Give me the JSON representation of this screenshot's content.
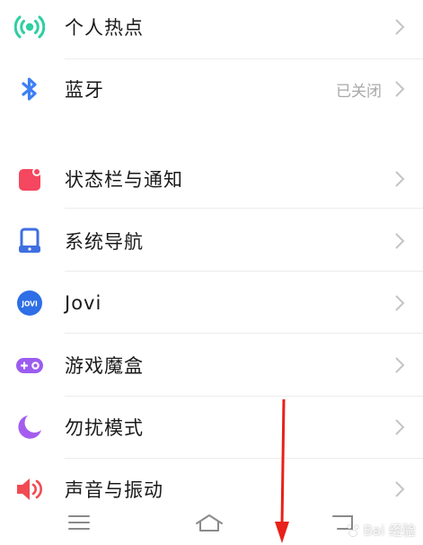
{
  "settings": {
    "hotspot": {
      "label": "个人热点",
      "icon": "hotspot-icon",
      "color": "#2ecfa0"
    },
    "bluetooth": {
      "label": "蓝牙",
      "status": "已关闭",
      "icon": "bluetooth-icon",
      "color": "#3d7ff5"
    },
    "statusbar": {
      "label": "状态栏与通知",
      "icon": "statusbar-notification-icon",
      "color": "#f5475f"
    },
    "navigation": {
      "label": "系统导航",
      "icon": "system-navigation-icon",
      "color": "#3f6fe0"
    },
    "jovi": {
      "label": "Jovi",
      "icon_text": "JOVI",
      "icon": "jovi-icon",
      "color": "#2e6ee6"
    },
    "game": {
      "label": "游戏魔盒",
      "icon": "game-box-icon",
      "color": "#9b5cf0"
    },
    "dnd": {
      "label": "勿扰模式",
      "icon": "moon-icon",
      "color": "#a45cf0"
    },
    "sound": {
      "label": "声音与振动",
      "icon": "speaker-icon",
      "color": "#f24a52"
    }
  },
  "navbar": {
    "menu_icon": "menu-icon",
    "home_icon": "home-icon",
    "back_icon": "back-icon"
  },
  "watermark": {
    "text": "Bai 经验"
  },
  "annotation": {
    "color": "#e8211a"
  }
}
